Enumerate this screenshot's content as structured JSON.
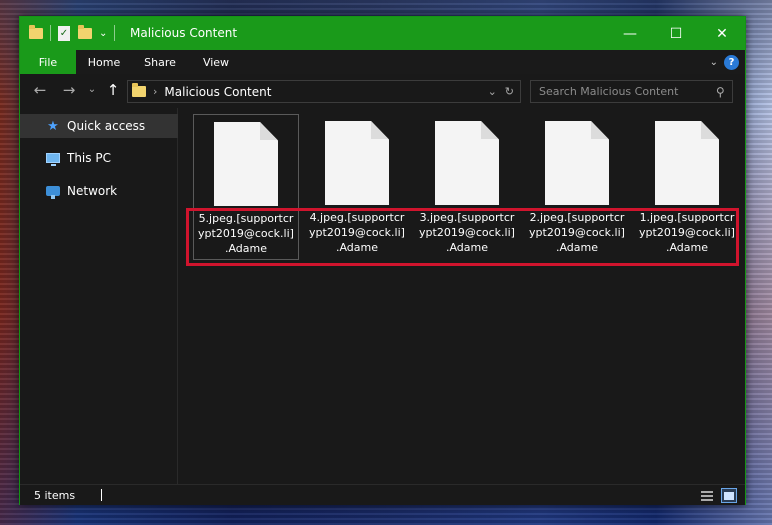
{
  "window": {
    "title": "Malicious Content",
    "controls": {
      "minimize": "—",
      "maximize": "☐",
      "close": "✕"
    }
  },
  "ribbon": {
    "tabs": [
      "File",
      "Home",
      "Share",
      "View"
    ],
    "expand": "⌄",
    "help": "?"
  },
  "nav": {
    "back": "←",
    "forward": "→",
    "recent": "⌄",
    "up": "↑",
    "address_separator": "›",
    "address": "Malicious Content",
    "address_dropdown": "⌄",
    "refresh": "↻",
    "search_placeholder": "Search Malicious Content"
  },
  "sidebar": {
    "items": [
      {
        "label": "Quick access",
        "icon": "star-icon",
        "selected": true
      },
      {
        "label": "This PC",
        "icon": "computer-icon",
        "selected": false
      },
      {
        "label": "Network",
        "icon": "network-icon",
        "selected": false
      }
    ]
  },
  "files": [
    {
      "label": "5.jpeg.[supportcr\nypt2019@cock.li]\n.Adame",
      "selected": true
    },
    {
      "label": "4.jpeg.[supportcr\nypt2019@cock.li]\n.Adame",
      "selected": false
    },
    {
      "label": "3.jpeg.[supportcr\nypt2019@cock.li]\n.Adame",
      "selected": false
    },
    {
      "label": "2.jpeg.[supportcr\nypt2019@cock.li]\n.Adame",
      "selected": false
    },
    {
      "label": "1.jpeg.[supportcr\nypt2019@cock.li]\n.Adame",
      "selected": false
    }
  ],
  "status": {
    "item_count": "5 items"
  },
  "colors": {
    "titlebar": "#1a9a1a",
    "highlight_box": "#d0142d"
  }
}
